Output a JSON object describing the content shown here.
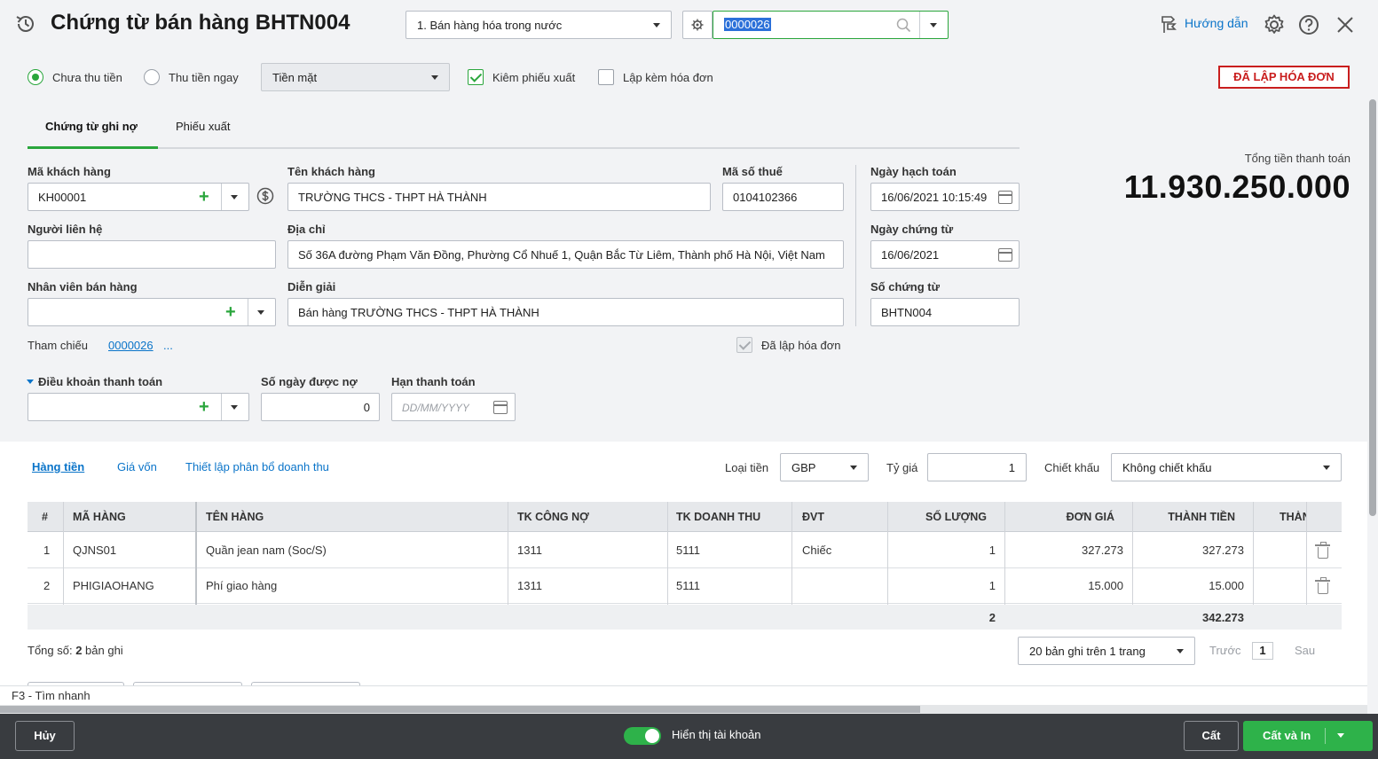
{
  "header": {
    "title": "Chứng từ bán hàng BHTN004",
    "sale_type": "1. Bán hàng hóa trong nước",
    "doc_search_value": "0000026",
    "help_label": "Hướng dẫn"
  },
  "options": {
    "unpaid_label": "Chưa thu tiền",
    "paid_now_label": "Thu tiền ngay",
    "payment_method": "Tiền mặt",
    "export_slip_label": "Kiêm phiếu xuất",
    "invoice_label": "Lập kèm hóa đơn",
    "status_badge": "ĐÃ LẬP HÓA ĐƠN"
  },
  "tabs": [
    "Chứng từ ghi nợ",
    "Phiếu xuất"
  ],
  "form": {
    "customer_code_label": "Mã khách hàng",
    "customer_code": "KH00001",
    "customer_name_label": "Tên khách hàng",
    "customer_name": "TRƯỜNG THCS - THPT HÀ THÀNH",
    "tax_code_label": "Mã số thuế",
    "tax_code": "0104102366",
    "contact_label": "Người liên hệ",
    "contact": "",
    "address_label": "Địa chỉ",
    "address": "Số 36A đường Phạm Văn Đồng, Phường Cổ Nhuế 1, Quận Bắc Từ Liêm, Thành phố Hà Nội, Việt Nam",
    "salesperson_label": "Nhân viên bán hàng",
    "salesperson": "",
    "description_label": "Diễn giải",
    "description": "Bán hàng TRƯỜNG THCS - THPT HÀ THÀNH",
    "reference_label": "Tham chiếu",
    "reference_value": "0000026",
    "reference_more": "...",
    "invoiced_label": "Đã lập hóa đơn",
    "posting_date_label": "Ngày hạch toán",
    "posting_date": "16/06/2021 10:15:49",
    "doc_date_label": "Ngày chứng từ",
    "doc_date": "16/06/2021",
    "doc_no_label": "Số chứng từ",
    "doc_no": "BHTN004",
    "payment_terms_label": "Điều khoản thanh toán",
    "payment_terms": "",
    "credit_days_label": "Số ngày được nợ",
    "credit_days": "0",
    "due_date_label": "Hạn thanh toán",
    "due_date_placeholder": "DD/MM/YYYY"
  },
  "total": {
    "label": "Tổng tiền thanh toán",
    "value": "11.930.250.000"
  },
  "detail_tabs": [
    "Hàng tiền",
    "Giá vốn",
    "Thiết lập phân bổ doanh thu"
  ],
  "currency": {
    "currency_label": "Loại tiền",
    "currency": "GBP",
    "rate_label": "Tỷ giá",
    "rate": "1",
    "discount_label": "Chiết khấu",
    "discount": "Không chiết khấu"
  },
  "table": {
    "headers": [
      "#",
      "MÃ HÀNG",
      "TÊN HÀNG",
      "TK CÔNG NỢ",
      "TK DOANH THU",
      "ĐVT",
      "SỐ LƯỢNG",
      "ĐƠN GIÁ",
      "THÀNH TIỀN",
      "THÀN"
    ],
    "rows": [
      [
        "1",
        "QJNS01",
        "Quần jean nam  (Soc/S)",
        "1311",
        "5111",
        "Chiếc",
        "1",
        "327.273",
        "327.273"
      ],
      [
        "2",
        "PHIGIAOHANG",
        "Phí giao hàng",
        "1311",
        "5111",
        "",
        "1",
        "15.000",
        "15.000"
      ]
    ],
    "sum_qty": "2",
    "sum_amount": "342.273"
  },
  "pager": {
    "total_prefix": "Tổng số: ",
    "total_count": "2",
    "total_suffix": " bản ghi",
    "page_size": "20 bản ghi trên 1 trang",
    "prev": "Trước",
    "page": "1",
    "next": "Sau"
  },
  "hint": "F3 - Tìm nhanh",
  "footer": {
    "cancel": "Hủy",
    "show_account": "Hiển thị tài khoản",
    "save": "Cất",
    "save_print": "Cất và In"
  }
}
